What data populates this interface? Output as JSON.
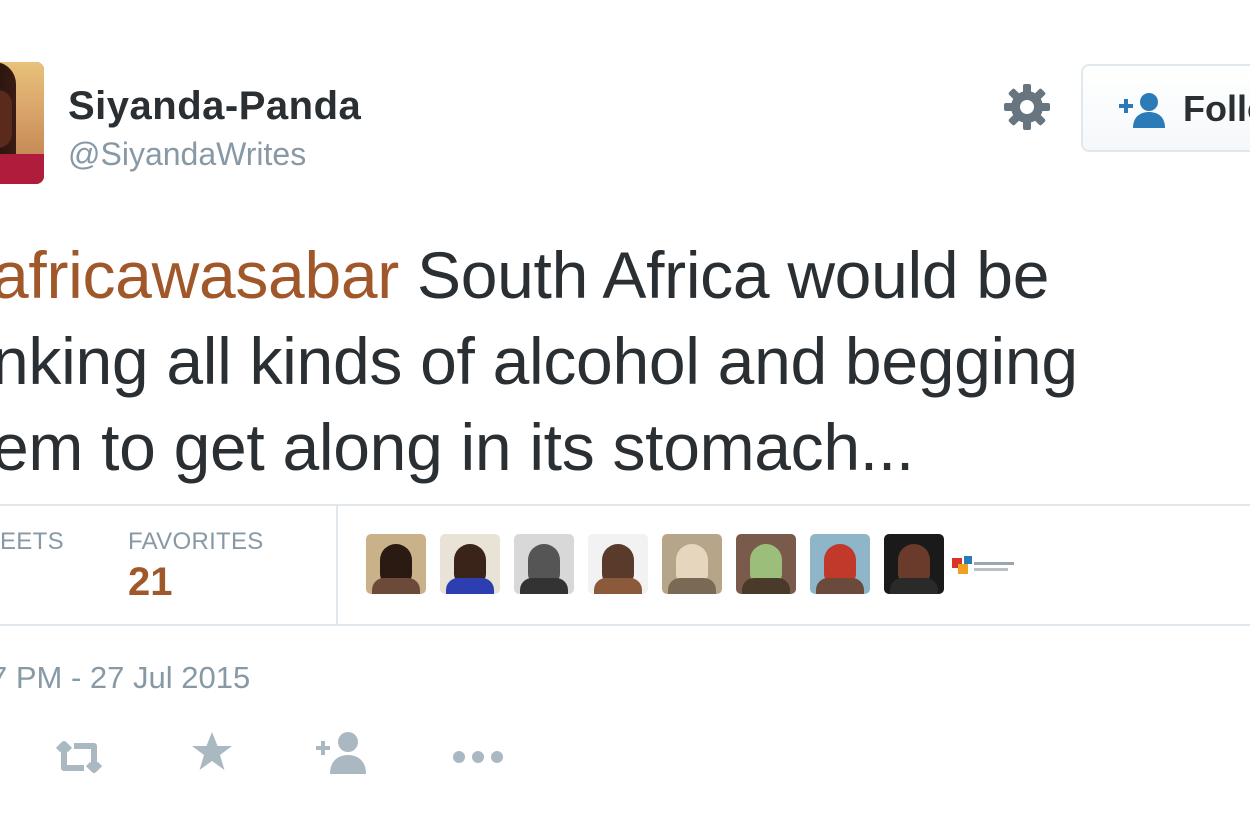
{
  "user": {
    "name": "Siyanda-Panda",
    "handle": "@SiyandaWrites"
  },
  "follow": {
    "label": "Follo"
  },
  "tweet": {
    "hashtag_part": "africawasabar",
    "line1_rest": " South Africa would be",
    "line2": "nking all kinds of alcohol and begging",
    "line3": "em to get along in its stomach..."
  },
  "stats": {
    "retweets_label": "EETS",
    "favorites_label": "FAVORITES",
    "favorites_value": "21"
  },
  "favoriters_count": 8,
  "timestamp": "7 PM - 27 Jul 2015",
  "icons": {
    "settings": "gear-icon",
    "follow": "add-user-icon",
    "reply_follow": "add-user-icon",
    "retweet": "retweet-icon",
    "favorite": "star-icon",
    "more": "more-dots-icon"
  },
  "colors": {
    "link": "#a0582a",
    "muted": "#8899a6",
    "text": "#292f33",
    "border": "#e1e8ed"
  }
}
